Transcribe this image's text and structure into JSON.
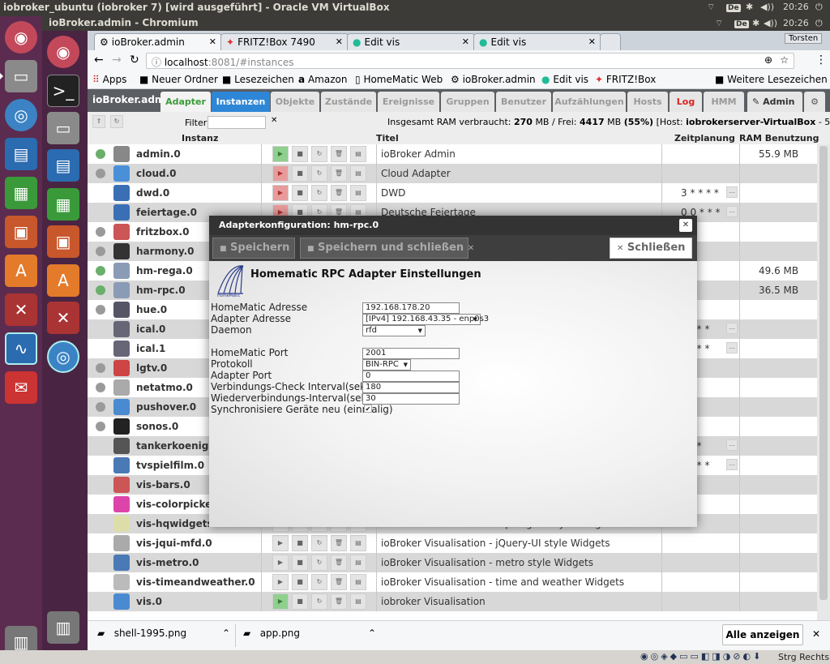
{
  "outer": {
    "title": "iobroker_ubuntu (iobroker 7) [wird ausgeführt] - Oracle VM VirtualBox",
    "kb": "De",
    "time": "20:26"
  },
  "inner": {
    "title": "ioBroker.admin - Chromium",
    "kb": "De",
    "time": "20:26",
    "user": "Torsten"
  },
  "tabs": [
    {
      "label": "ioBroker.admin"
    },
    {
      "label": "FRITZ!Box 7490"
    },
    {
      "label": "Edit vis"
    },
    {
      "label": "Edit vis"
    }
  ],
  "url": {
    "host": "localhost",
    "rest": ":8081/#instances"
  },
  "bookmarks": [
    "Apps",
    "Neuer Ordner",
    "Lesezeichen",
    "Amazon",
    "HomeMatic Web",
    "ioBroker.admin",
    "Edit vis",
    "FRITZ!Box",
    "Weitere Lesezeichen"
  ],
  "nav": {
    "brand": "ioBroker.admin",
    "tabs": [
      "Adapter",
      "Instanzen",
      "Objekte",
      "Zustände",
      "Ereignisse",
      "Gruppen",
      "Benutzer",
      "Aufzählungen",
      "Hosts",
      "Log",
      "HMM"
    ],
    "admin": "Admin"
  },
  "subbar": {
    "filter": "Filter:",
    "ram_prefix": "Insgesamt RAM verbraucht:",
    "ram_used": "270",
    "ram_mid": "MB / Frei:",
    "ram_free": "4417",
    "ram_mid2": "MB",
    "ram_pct": "(55%)",
    "host_prefix": "[Host:",
    "host": "iobrokerserver-VirtualBox",
    "host_suffix": "- 5 Prozesse]"
  },
  "columns": {
    "instance": "Instanz",
    "title": "Titel",
    "schedule": "Zeitplanung",
    "ram": "RAM Benutzung"
  },
  "rows": [
    {
      "name": "admin.0",
      "title": "ioBroker Admin",
      "sched": "",
      "ram": "55.9 MB",
      "dot": "#6ab06a",
      "play": "on",
      "icon": "#888"
    },
    {
      "name": "cloud.0",
      "title": "Cloud Adapter",
      "sched": "",
      "ram": "",
      "dot": "#9a9a9a",
      "play": "off",
      "icon": "#4a90d9"
    },
    {
      "name": "dwd.0",
      "title": "DWD",
      "sched": "3 * * * *",
      "ram": "",
      "dot": "",
      "play": "off",
      "icon": "#3a6fb5"
    },
    {
      "name": "feiertage.0",
      "title": "Deutsche Feiertage",
      "sched": "0 0 * * *",
      "ram": "",
      "dot": "",
      "play": "off",
      "icon": "#3a6fb5"
    },
    {
      "name": "fritzbox.0",
      "title": "",
      "sched": "",
      "ram": "",
      "dot": "#9a9a9a",
      "play": "",
      "icon": "#c55"
    },
    {
      "name": "harmony.0",
      "title": "",
      "sched": "",
      "ram": "",
      "dot": "#9a9a9a",
      "play": "",
      "icon": "#333"
    },
    {
      "name": "hm-rega.0",
      "title": "",
      "sched": "",
      "ram": "49.6 MB",
      "dot": "#6ab06a",
      "play": "",
      "icon": "#8a9bb5"
    },
    {
      "name": "hm-rpc.0",
      "title": "",
      "sched": "",
      "ram": "36.5 MB",
      "dot": "#6ab06a",
      "play": "",
      "icon": "#8a9bb5"
    },
    {
      "name": "hue.0",
      "title": "",
      "sched": "",
      "ram": "",
      "dot": "#9a9a9a",
      "play": "",
      "icon": "#556"
    },
    {
      "name": "ical.0",
      "title": "",
      "sched": "* * * *",
      "ram": "",
      "dot": "",
      "play": "",
      "icon": "#667"
    },
    {
      "name": "ical.1",
      "title": "",
      "sched": "* * * *",
      "ram": "",
      "dot": "",
      "play": "",
      "icon": "#667"
    },
    {
      "name": "lgtv.0",
      "title": "",
      "sched": "",
      "ram": "",
      "dot": "#9a9a9a",
      "play": "",
      "icon": "#c44"
    },
    {
      "name": "netatmo.0",
      "title": "",
      "sched": "",
      "ram": "",
      "dot": "#9a9a9a",
      "play": "",
      "icon": "#aaa"
    },
    {
      "name": "pushover.0",
      "title": "",
      "sched": "",
      "ram": "",
      "dot": "#9a9a9a",
      "play": "",
      "icon": "#4a8ad0"
    },
    {
      "name": "sonos.0",
      "title": "",
      "sched": "",
      "ram": "",
      "dot": "#9a9a9a",
      "play": "",
      "icon": "#222"
    },
    {
      "name": "tankerkoenig.0",
      "title": "",
      "sched": "* * *",
      "ram": "",
      "dot": "",
      "play": "",
      "icon": "#555"
    },
    {
      "name": "tvspielfilm.0",
      "title": "",
      "sched": "* * * *",
      "ram": "",
      "dot": "",
      "play": "",
      "icon": "#4a7ab5"
    },
    {
      "name": "vis-bars.0",
      "title": "",
      "sched": "",
      "ram": "",
      "dot": "",
      "play": "",
      "icon": "#c55"
    },
    {
      "name": "vis-colorpicker.0",
      "title": "",
      "sched": "",
      "ram": "",
      "dot": "",
      "play": "",
      "icon": "#d4a"
    },
    {
      "name": "vis-hqwidgets.0",
      "title": "ioBroker Visualisation - hqWidgets style Widgets",
      "sched": "",
      "ram": "",
      "dot": "",
      "play": "",
      "icon": "#dda"
    },
    {
      "name": "vis-jqui-mfd.0",
      "title": "ioBroker Visualisation - jQuery-UI style Widgets",
      "sched": "",
      "ram": "",
      "dot": "",
      "play": "",
      "icon": "#aaa"
    },
    {
      "name": "vis-metro.0",
      "title": "ioBroker Visualisation - metro style Widgets",
      "sched": "",
      "ram": "",
      "dot": "",
      "play": "",
      "icon": "#4a7ab5"
    },
    {
      "name": "vis-timeandweather.0",
      "title": "ioBroker Visualisation - time and weather Widgets",
      "sched": "",
      "ram": "",
      "dot": "",
      "play": "",
      "icon": "#bbb"
    },
    {
      "name": "vis.0",
      "title": "iobroker Visualisation",
      "sched": "",
      "ram": "",
      "dot": "",
      "play": "on",
      "icon": "#4a8ad0"
    }
  ],
  "dialog": {
    "title": "Adapterkonfiguration: hm-rpc.0",
    "save": "Speichern",
    "save_close": "Speichern und schließen",
    "close": "Schließen",
    "heading": "Homematic RPC Adapter Einstellungen",
    "logo_text": "HomeMatic",
    "fields": [
      {
        "label": "HomeMatic Adresse",
        "value": "192.168.178.20",
        "type": "input"
      },
      {
        "label": "Adapter Adresse",
        "value": "[IPv4] 192.168.43.35 - enp0s3",
        "type": "select"
      },
      {
        "label": "Daemon",
        "value": "rfd",
        "type": "select"
      },
      {
        "label": "HomeMatic Port",
        "value": "2001",
        "type": "input"
      },
      {
        "label": "Protokoll",
        "value": "BIN-RPC",
        "type": "select"
      },
      {
        "label": "Adapter Port",
        "value": "0",
        "type": "input"
      },
      {
        "label": "Verbindungs-Check Interval(sek)",
        "value": "180",
        "type": "input"
      },
      {
        "label": "Wiederverbindungs-Interval(sek)",
        "value": "30",
        "type": "input"
      },
      {
        "label": "Synchronisiere Geräte neu (einmalig)",
        "value": "✔",
        "type": "checkbox"
      }
    ]
  },
  "downloads": {
    "items": [
      "shell-1995.png",
      "app.png"
    ],
    "show_all": "Alle anzeigen"
  },
  "status": {
    "host_key": "Strg Rechts"
  }
}
